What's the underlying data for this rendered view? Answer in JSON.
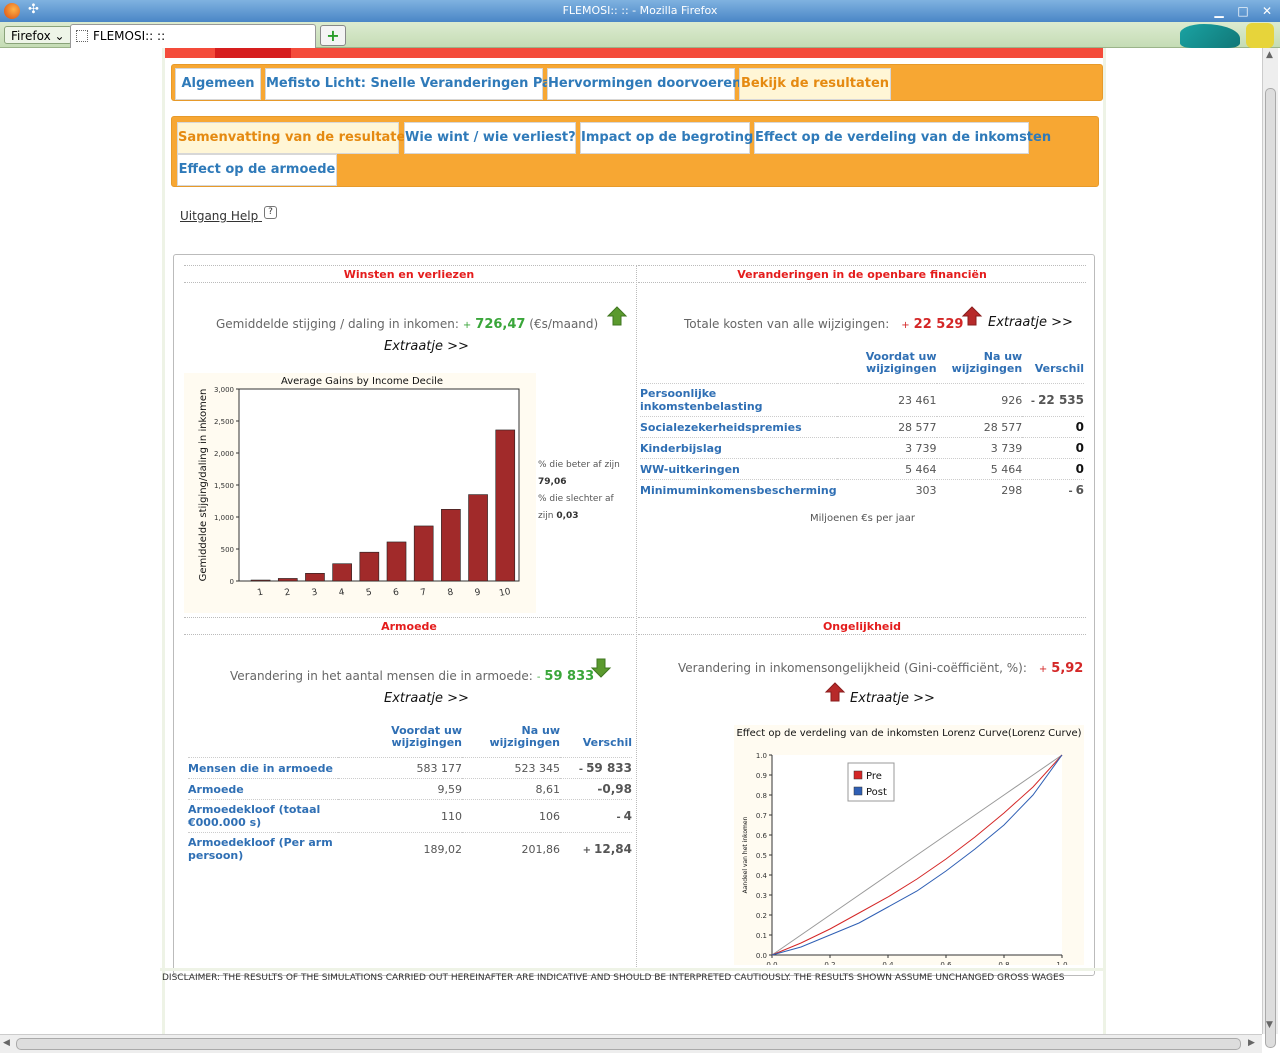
{
  "window": {
    "title": "FLEMOSI:: :: - Mozilla Firefox",
    "menu_label": "Firefox",
    "tab_label": "FLEMOSI::  ::"
  },
  "main_tabs": [
    {
      "label": "Algemeen",
      "active": false
    },
    {
      "label": "Mefisto Licht: Snelle Veranderingen Page",
      "active": false
    },
    {
      "label": "Hervormingen doorvoeren",
      "active": false
    },
    {
      "label": "Bekijk de resultaten",
      "active": true
    }
  ],
  "sub_tabs": [
    {
      "label": "Samenvatting van de resultaten",
      "active": true
    },
    {
      "label": "Wie wint / wie verliest?",
      "active": false
    },
    {
      "label": "Impact op de begroting",
      "active": false
    },
    {
      "label": "Effect op de verdeling van de inkomsten",
      "active": false
    },
    {
      "label": "Effect op de armoede",
      "active": false
    }
  ],
  "help": {
    "label": "Uitgang Help",
    "icon": "?"
  },
  "colors": {
    "accent_orange": "#f7a733",
    "link_blue": "#2f7ab9",
    "title_red": "#e41c1c",
    "gain_green": "#3aa63a",
    "loss_red": "#d42727",
    "bar": "#a12a2a"
  },
  "gains": {
    "title": "Winsten en verliezen",
    "label": "Gemiddelde stijging / daling in inkomen:",
    "sign": "+",
    "value": "726,47",
    "unit": "(€s/maand)",
    "arrow": "arrow-up-green-icon",
    "extraatje": "Extraatje >>",
    "side_better": "% die beter af zijn",
    "side_better_val": "79,06",
    "side_worse": "% die slechter af zijn",
    "side_worse_val": "0,03"
  },
  "finance": {
    "title": "Veranderingen in de openbare financiën",
    "label": "Totale kosten van alle wijzigingen:",
    "sign": "+",
    "value": "22 529",
    "arrow": "arrow-up-red-icon",
    "extraatje": "Extraatje >>",
    "columns": [
      "Voordat uw wijzigingen",
      "Na uw wijzigingen",
      "Verschil"
    ],
    "rows": [
      {
        "label": "Persoonlijke inkomstenbelasting",
        "before": "23 461",
        "after": "926",
        "sign": "-",
        "diff": "22 535",
        "kind": "red"
      },
      {
        "label": "Socialezekerheidspremies",
        "before": "28 577",
        "after": "28 577",
        "sign": "",
        "diff": "0",
        "kind": "zero"
      },
      {
        "label": "Kinderbijslag",
        "before": "3 739",
        "after": "3 739",
        "sign": "",
        "diff": "0",
        "kind": "zero"
      },
      {
        "label": "WW-uitkeringen",
        "before": "5 464",
        "after": "5 464",
        "sign": "",
        "diff": "0",
        "kind": "zero"
      },
      {
        "label": "Minimuminkomensbescherming",
        "before": "303",
        "after": "298",
        "sign": "-",
        "diff": "6",
        "kind": "green"
      }
    ],
    "note": "Miljoenen €s per jaar"
  },
  "poverty": {
    "title": "Armoede",
    "label": "Verandering in het aantal mensen die in armoede:",
    "sign": "-",
    "value": "59 833",
    "arrow": "arrow-down-green-icon",
    "extraatje": "Extraatje >>",
    "columns": [
      "Voordat uw wijzigingen",
      "Na uw wijzigingen",
      "Verschil"
    ],
    "rows": [
      {
        "label": "Mensen die in armoede",
        "before": "583 177",
        "after": "523 345",
        "sign": "-",
        "diff": "59 833",
        "kind": "green"
      },
      {
        "label": "Armoede",
        "before": "9,59",
        "after": "8,61",
        "sign": "",
        "diff": "-0,98",
        "kind": "green"
      },
      {
        "label": "Armoedekloof (totaal €000.000 s)",
        "before": "110",
        "after": "106",
        "sign": "-",
        "diff": "4",
        "kind": "green"
      },
      {
        "label": "Armoedekloof (Per arm persoon)",
        "before": "189,02",
        "after": "201,86",
        "sign": "+",
        "diff": "12,84",
        "kind": "red"
      }
    ]
  },
  "inequality": {
    "title": "Ongelijkheid",
    "label": "Verandering in inkomensongelijkheid (Gini-coëfficiënt, %):",
    "sign": "+",
    "value": "5,92",
    "arrow": "arrow-up-red-icon",
    "extraatje": "Extraatje >>"
  },
  "disclaimer": "DISCLAIMER: THE RESULTS OF THE SIMULATIONS CARRIED OUT HEREINAFTER ARE INDICATIVE AND SHOULD BE INTERPRETED CAUTIOUSLY. THE RESULTS SHOWN ASSUME UNCHANGED GROSS WAGES",
  "chart_data": [
    {
      "type": "bar",
      "title": "Average Gains by Income Decile",
      "xlabel": "",
      "ylabel": "Gemiddelde stijging/daling in inkomen",
      "categories": [
        "1",
        "2",
        "3",
        "4",
        "5",
        "6",
        "7",
        "8",
        "9",
        "10"
      ],
      "values": [
        15,
        40,
        120,
        270,
        450,
        610,
        860,
        1120,
        1350,
        2360
      ],
      "ylim": [
        0,
        3000
      ],
      "yticks": [
        "0",
        "500",
        "1,000",
        "1,500",
        "2,000",
        "2,500",
        "3,000"
      ],
      "grid": false
    },
    {
      "type": "line",
      "title": "Effect op de verdeling van de inkomsten Lorenz Curve(Lorenz Curve)",
      "xlabel": "",
      "ylabel": "Aandeel van het inkomen",
      "x": [
        0,
        0.1,
        0.2,
        0.3,
        0.4,
        0.5,
        0.6,
        0.7,
        0.8,
        0.9,
        1.0
      ],
      "xticks": [
        "0.0",
        "0.2",
        "0.4",
        "0.6",
        "0.8",
        "1.0"
      ],
      "yticks": [
        "0.0",
        "0.1",
        "0.2",
        "0.3",
        "0.4",
        "0.5",
        "0.6",
        "0.7",
        "0.8",
        "0.9",
        "1.0"
      ],
      "xlim": [
        0,
        1
      ],
      "ylim": [
        0,
        1
      ],
      "legend": "top-left",
      "series": [
        {
          "name": "",
          "color": "#999999",
          "values": [
            0,
            0.1,
            0.2,
            0.3,
            0.4,
            0.5,
            0.6,
            0.7,
            0.8,
            0.9,
            1.0
          ]
        },
        {
          "name": "Pre",
          "color": "#d42727",
          "values": [
            0,
            0.06,
            0.13,
            0.21,
            0.29,
            0.38,
            0.48,
            0.59,
            0.71,
            0.84,
            1.0
          ]
        },
        {
          "name": "Post",
          "color": "#2f5fb4",
          "values": [
            0,
            0.04,
            0.1,
            0.16,
            0.24,
            0.32,
            0.42,
            0.53,
            0.65,
            0.8,
            1.0
          ]
        }
      ]
    }
  ]
}
